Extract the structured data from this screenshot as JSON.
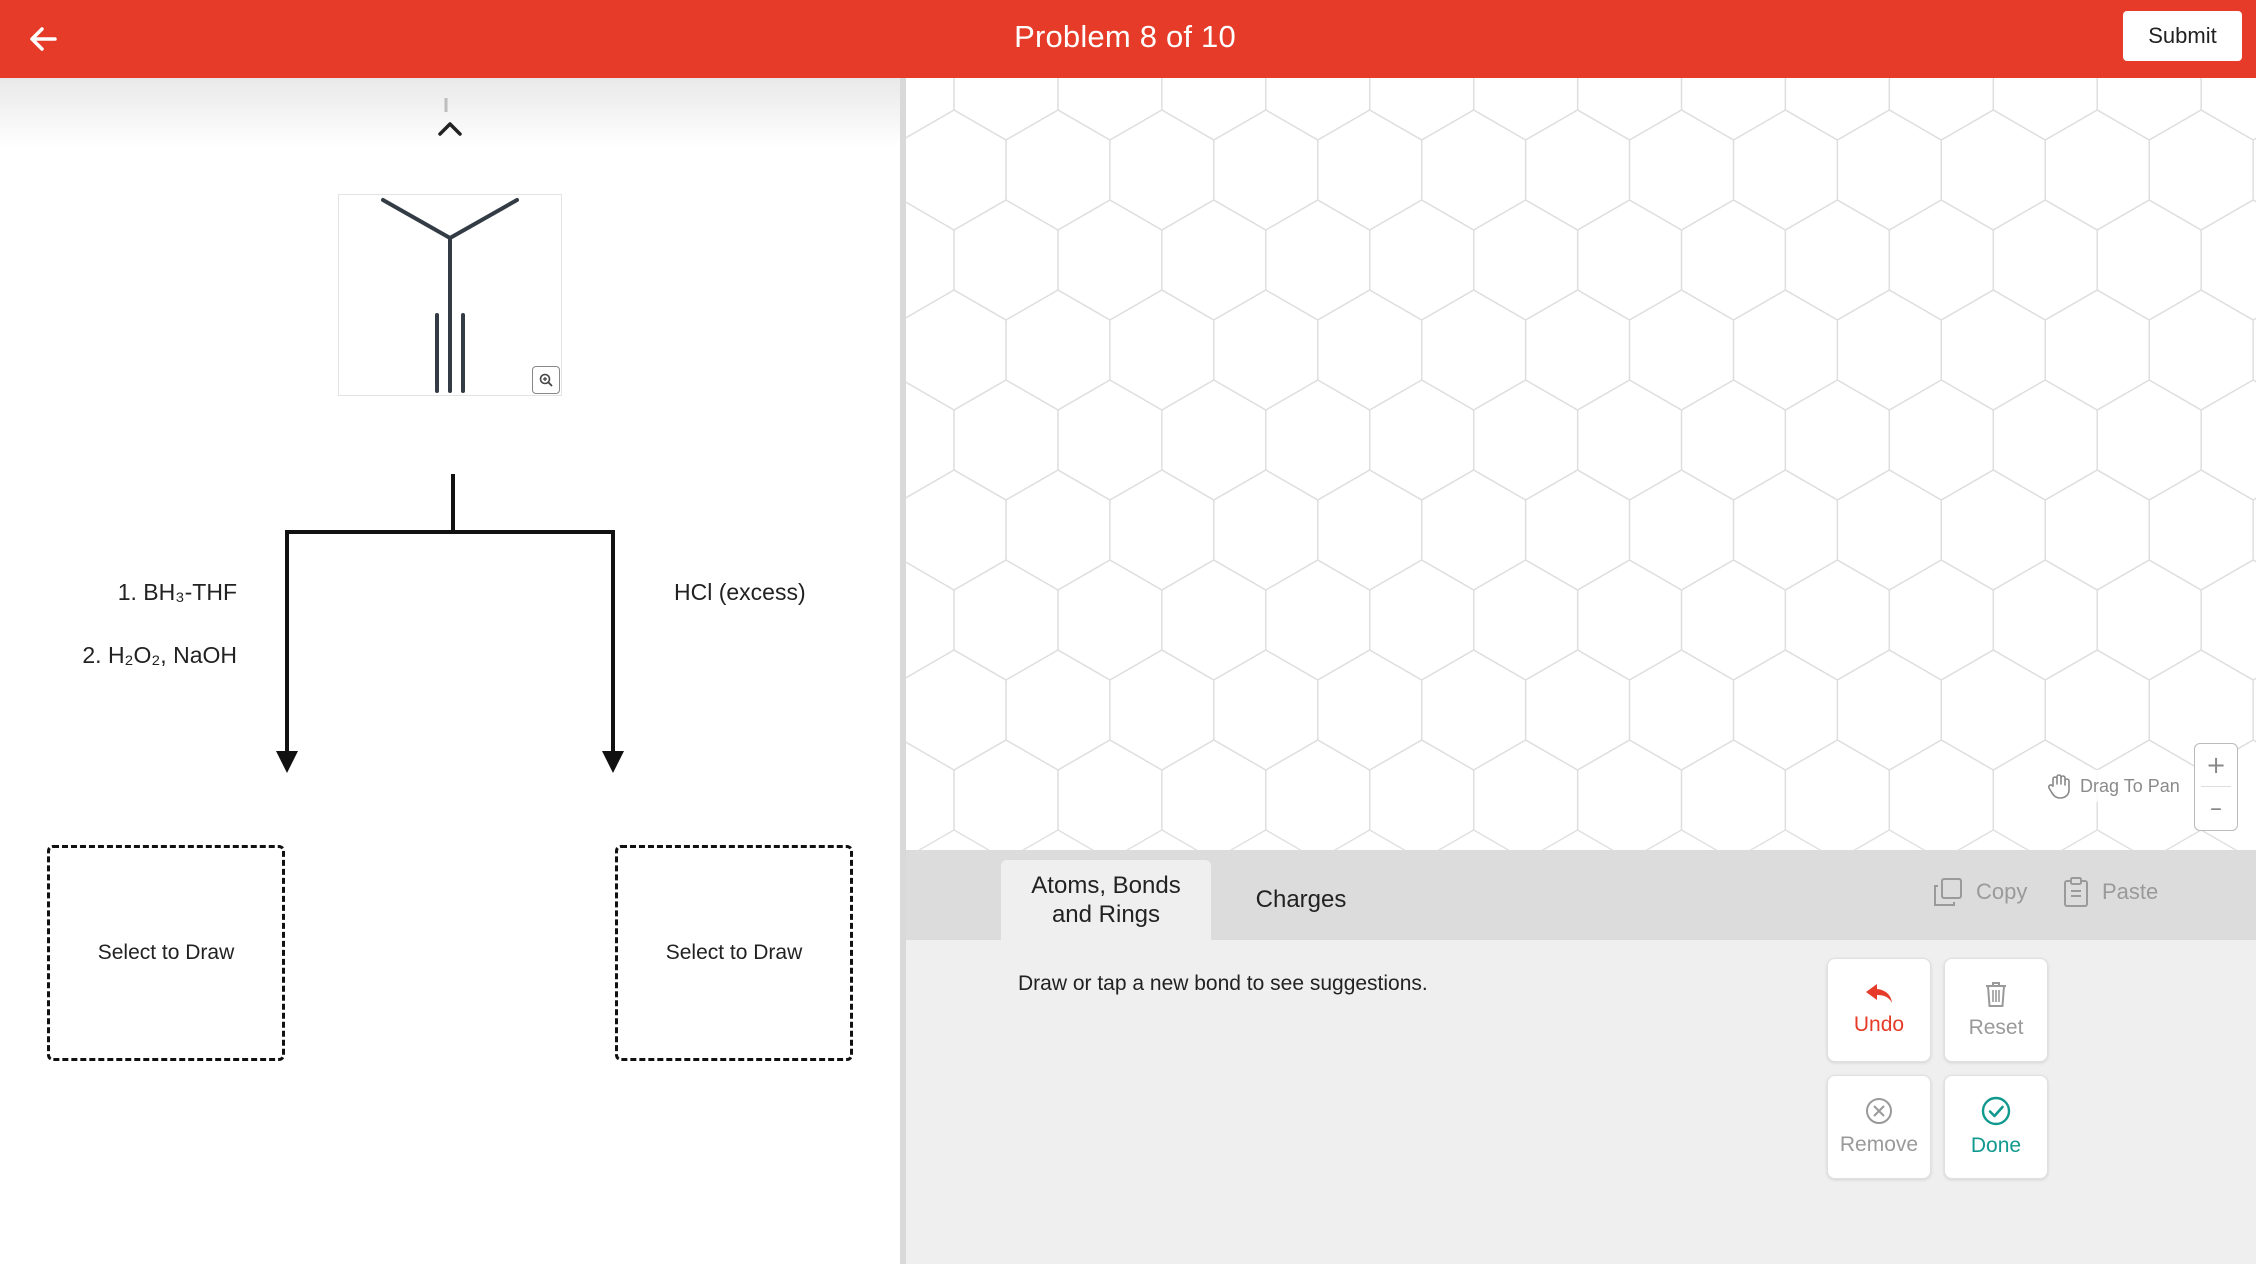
{
  "header": {
    "title": "Problem 8 of 10",
    "submit_label": "Submit",
    "color": "#e63b28"
  },
  "reaction": {
    "left_reagents": [
      "1. BH₃-THF",
      "2. H₂O₂, NaOH"
    ],
    "right_reagent": "HCl (excess)",
    "left_box_label": "Select to Draw",
    "right_box_label": "Select to Draw"
  },
  "canvas": {
    "pan_hint": "Drag To Pan",
    "zoom_in": "+",
    "zoom_out": "–"
  },
  "tools": {
    "tabs": [
      {
        "label": "Atoms, Bonds and Rings",
        "active": true
      },
      {
        "label": "Charges",
        "active": false
      }
    ],
    "copy_label": "Copy",
    "paste_label": "Paste",
    "hint": "Draw or tap a new bond to see suggestions.",
    "buttons": {
      "undo": "Undo",
      "reset": "Reset",
      "remove": "Remove",
      "done": "Done"
    },
    "colors": {
      "undo": "#e63b28",
      "done": "#11998e",
      "disabled": "#9a9a9a"
    }
  }
}
